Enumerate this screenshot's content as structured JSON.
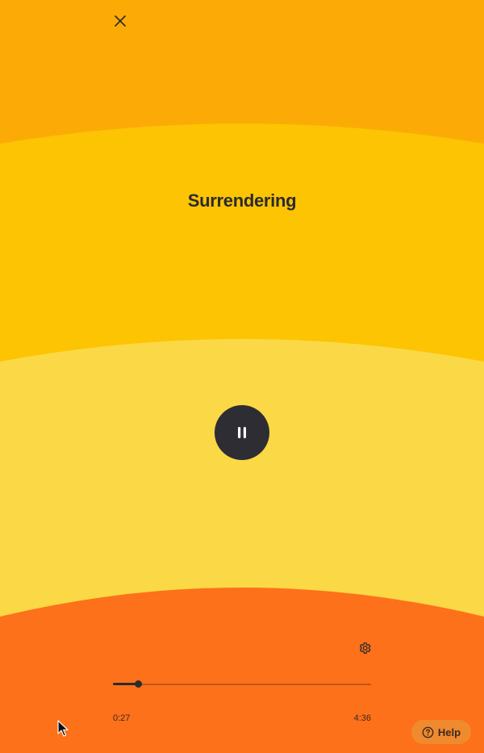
{
  "player": {
    "title": "Surrendering",
    "elapsed": "0:27",
    "total": "4:36",
    "progress_fraction": 0.098
  },
  "help": {
    "label": "Help"
  },
  "icons": {
    "close": "close-icon",
    "pause": "pause-icon",
    "settings": "gear-icon",
    "help": "question-circle-icon",
    "cursor": "mouse-pointer-icon"
  },
  "colors": {
    "band_top": "#fcab06",
    "band_2": "#fcc402",
    "band_3": "#fbd845",
    "band_bottom": "#fd711a",
    "dark": "#2e2d33",
    "help_bg": "#f08a2e"
  }
}
